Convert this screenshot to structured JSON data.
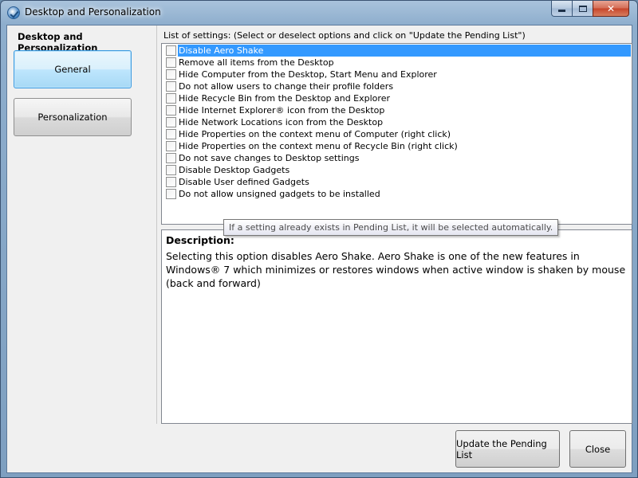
{
  "window": {
    "title": "Desktop and Personalization"
  },
  "sidebar": {
    "title": "Desktop and Personalization",
    "items": [
      {
        "label": "General",
        "selected": true
      },
      {
        "label": "Personalization",
        "selected": false
      }
    ]
  },
  "settings": {
    "header": "List of settings: (Select or deselect options and click on \"Update the Pending List\")",
    "items": [
      {
        "label": "Disable Aero Shake",
        "checked": false,
        "selected": true
      },
      {
        "label": "Remove all items from the Desktop",
        "checked": false
      },
      {
        "label": "Hide Computer from the Desktop, Start Menu and Explorer",
        "checked": false
      },
      {
        "label": "Do not allow users to change their profile folders",
        "checked": false
      },
      {
        "label": "Hide Recycle Bin from the Desktop and Explorer",
        "checked": false
      },
      {
        "label": "Hide Internet Explorer® icon from the Desktop",
        "checked": false
      },
      {
        "label": "Hide Network Locations icon from the Desktop",
        "checked": false
      },
      {
        "label": "Hide Properties on the context menu of Computer (right click)",
        "checked": false
      },
      {
        "label": "Hide Properties on the context menu of Recycle Bin (right click)",
        "checked": false
      },
      {
        "label": "Do not save changes to Desktop settings",
        "checked": false
      },
      {
        "label": "Disable Desktop Gadgets",
        "checked": false
      },
      {
        "label": "Disable User defined Gadgets",
        "checked": false
      },
      {
        "label": "Do not allow unsigned gadgets to be installed",
        "checked": false
      }
    ],
    "tooltip": "If a setting already exists in Pending List, it will be selected automatically."
  },
  "description": {
    "title": "Description:",
    "text": "Selecting this option disables Aero Shake. Aero Shake is one of the new features in Windows® 7 which minimizes or restores windows when active window is shaken by mouse (back and forward)"
  },
  "buttons": {
    "update": "Update the Pending List",
    "close": "Close"
  },
  "colors": {
    "selection": "#3399ff",
    "nav_active_border": "#3c9be0"
  }
}
